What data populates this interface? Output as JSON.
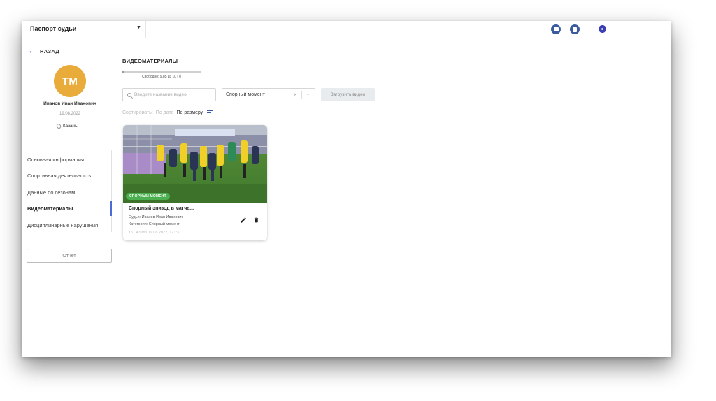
{
  "header": {
    "app_title": "Паспорт судьи",
    "icons": [
      "image-icon",
      "book-icon",
      "user-dot-icon"
    ]
  },
  "sidebar": {
    "back_label": "НАЗАД",
    "avatar_initials": "ТМ",
    "avatar_color": "#e9ab3a",
    "name": "Иванов Иван Иванович",
    "date": "19.08.2022",
    "city": "Казань",
    "nav_items": [
      {
        "label": "Основная информация",
        "active": false
      },
      {
        "label": "Спортивная деятельность",
        "active": false
      },
      {
        "label": "Данные по сезонам",
        "active": false
      },
      {
        "label": "Видеоматериалы",
        "active": true
      },
      {
        "label": "Дисциплинарные нарушения",
        "active": false
      }
    ],
    "report_button": "Отчет"
  },
  "main": {
    "section_title": "ВИДЕОМАТЕРИАЛЫ",
    "storage": {
      "label": "Свободно: 9.85 из 10 Гб",
      "used_fraction": 0.015
    },
    "search": {
      "placeholder": "Введите название видео",
      "value": ""
    },
    "category_select": {
      "value": "Спорный момент"
    },
    "upload_button": "Загрузить видео",
    "sort": {
      "label": "Сортировать:",
      "options": [
        {
          "label": "По дате",
          "active": false
        },
        {
          "label": "По размеру",
          "active": true
        }
      ]
    },
    "videos": [
      {
        "badge": "СПОРНЫЙ МОМЕНТ",
        "title": "Спорный эпизод в матче...",
        "judge": "Судья: Иванов Иван Иванович",
        "category": "Категория: Спорный момент",
        "info": "151.43 Мб 19.08.2022, 12:23"
      }
    ]
  },
  "colors": {
    "accent": "#3a5ba0",
    "nav_active": "#4a6bd8",
    "badge_green": "#4caf50"
  }
}
